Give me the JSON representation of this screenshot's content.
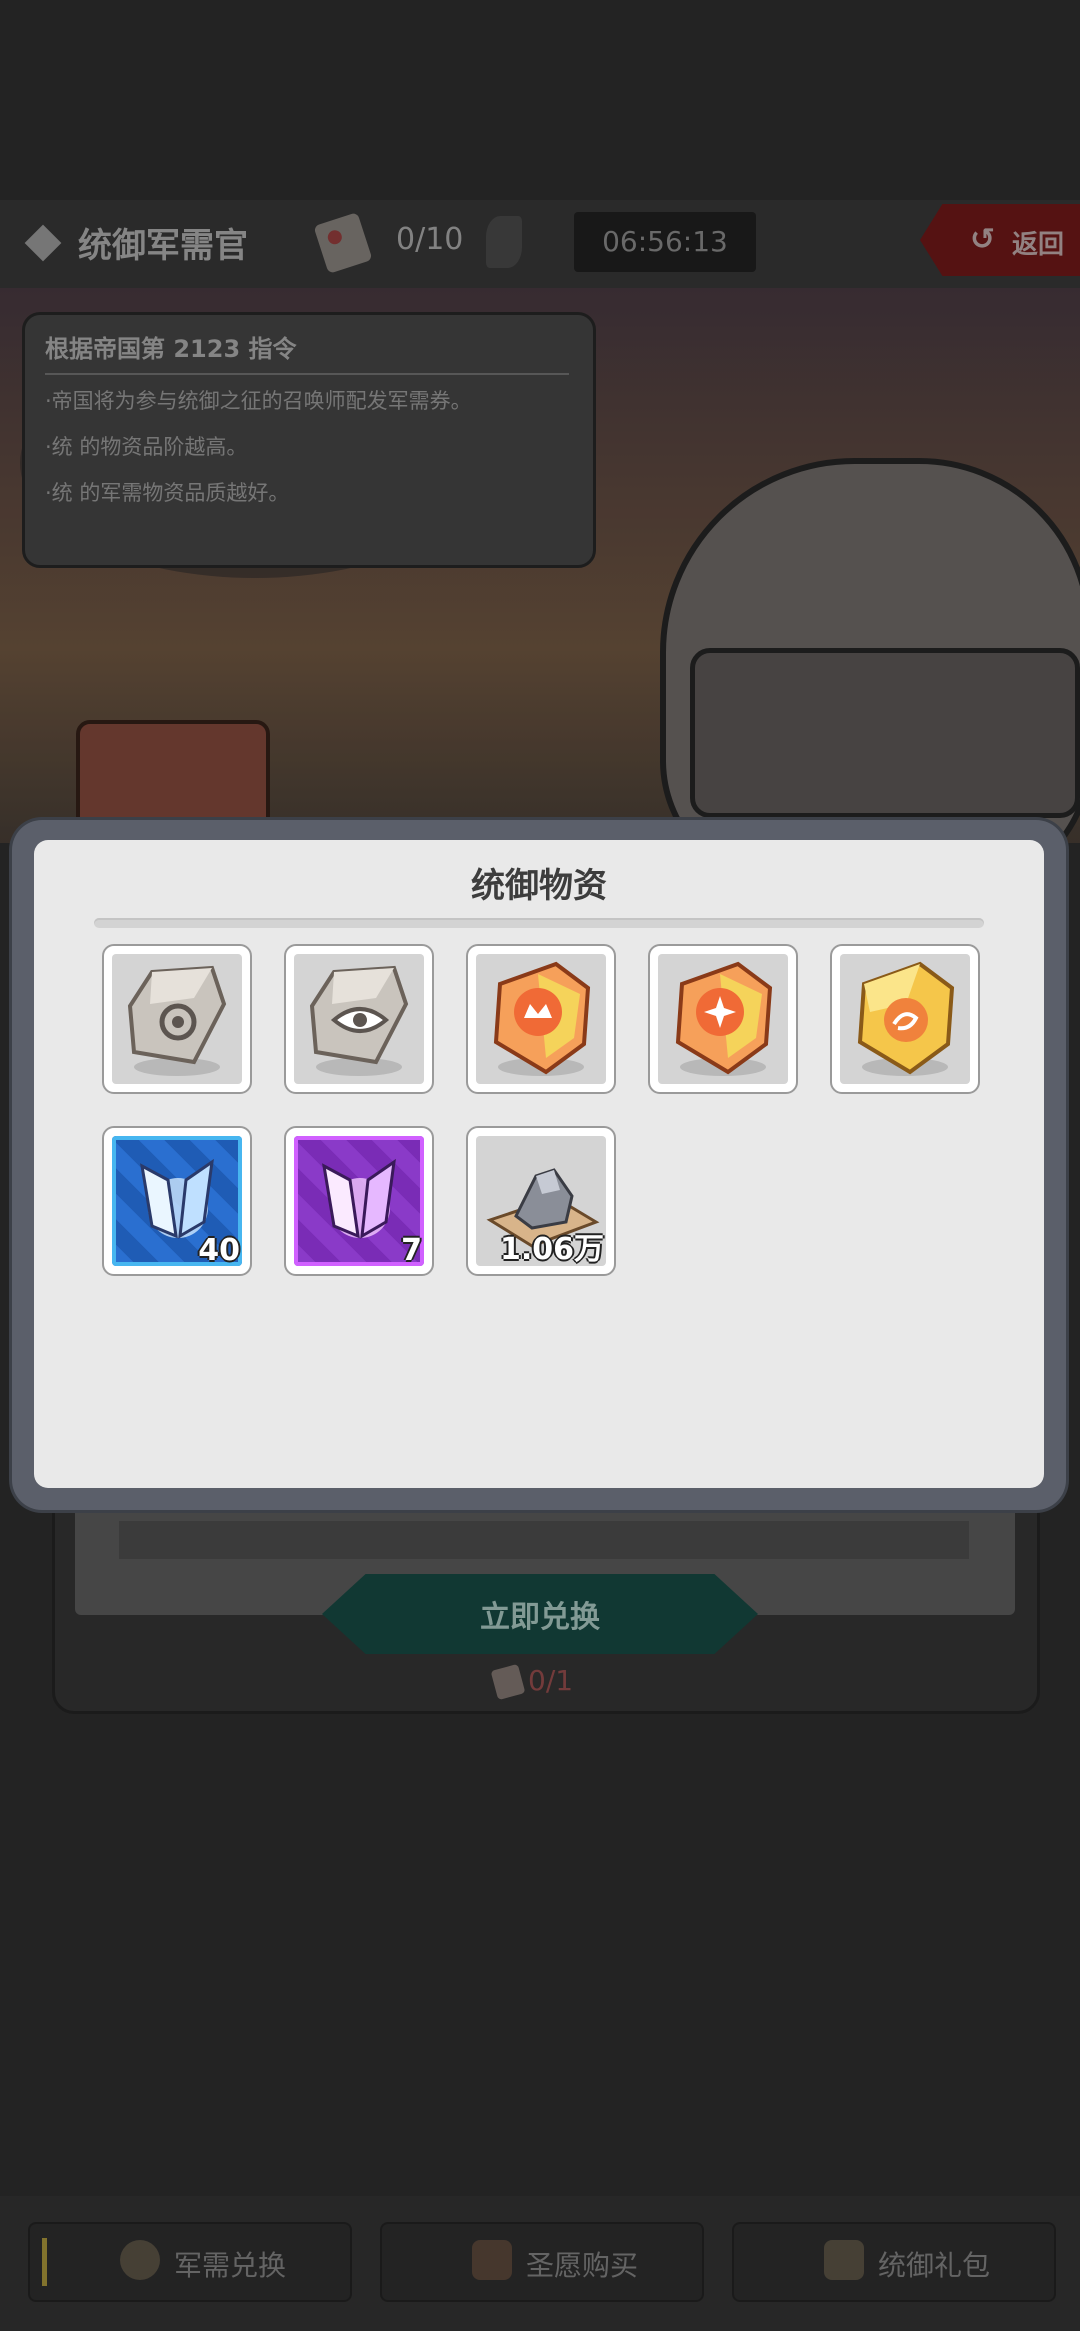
{
  "header": {
    "title": "统御军需官",
    "ticket_count": "0/10",
    "timer": "06:56:13",
    "back_label": "返回"
  },
  "notice": {
    "title": "根据帝国第 2123 指令",
    "lines": [
      "·帝国将为参与统御之征的召唤师配发军需券。",
      "·统            的物资品阶越高。",
      "·统            的军需物资品质越好。"
    ]
  },
  "exchange": {
    "button_label": "立即兑换",
    "count": "0/1"
  },
  "tabs": [
    {
      "label": "军需兑换",
      "active": true
    },
    {
      "label": "圣愿购买",
      "active": false
    },
    {
      "label": "统御礼包",
      "active": false
    }
  ],
  "modal": {
    "title": "统御物资",
    "items": [
      {
        "icon": "gray-gem-ring-icon",
        "quantity": ""
      },
      {
        "icon": "gray-gem-eye-icon",
        "quantity": ""
      },
      {
        "icon": "orange-gem-crown-icon",
        "quantity": ""
      },
      {
        "icon": "orange-gem-star-icon",
        "quantity": ""
      },
      {
        "icon": "yellow-gem-swirl-icon",
        "quantity": ""
      },
      {
        "icon": "blue-crystal-icon",
        "quantity": "40"
      },
      {
        "icon": "purple-crystal-icon",
        "quantity": "7"
      },
      {
        "icon": "ore-pile-icon",
        "quantity": "1.06万"
      }
    ]
  },
  "colors": {
    "modal_bg": "#e9e9e9",
    "modal_frame": "#5b5f6a",
    "gem_orange": "#f07a3c",
    "gem_yellow": "#f5c64a",
    "gem_gray": "#c9c4bd"
  }
}
